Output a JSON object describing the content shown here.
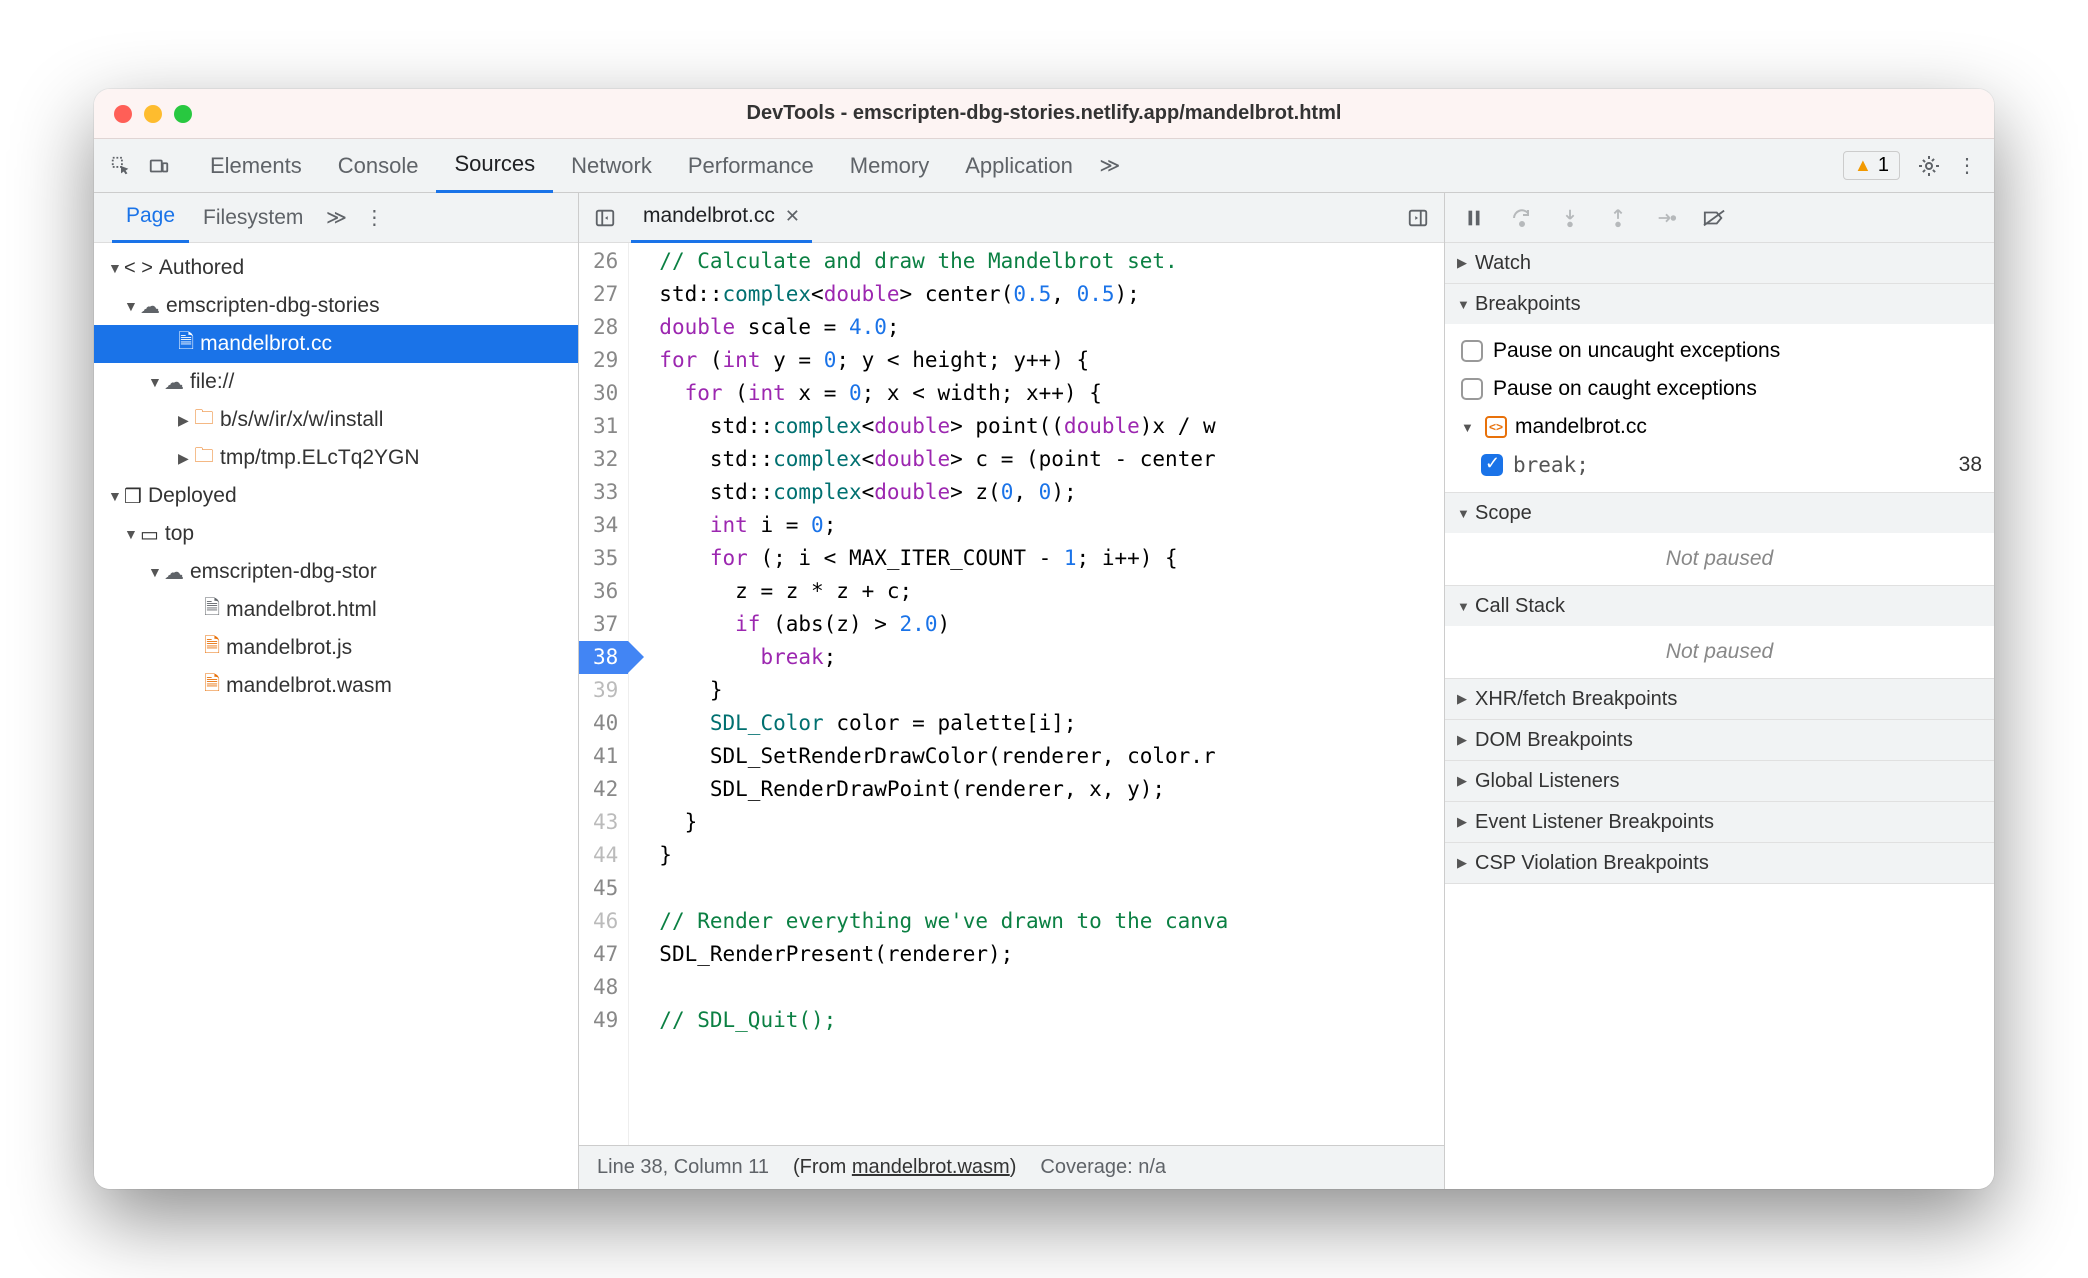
{
  "window_title": "DevTools - emscripten-dbg-stories.netlify.app/mandelbrot.html",
  "tabs": {
    "elements": "Elements",
    "console": "Console",
    "sources": "Sources",
    "network": "Network",
    "performance": "Performance",
    "memory": "Memory",
    "application": "Application"
  },
  "warnings_count": "1",
  "navigator": {
    "tabs": {
      "page": "Page",
      "filesystem": "Filesystem"
    },
    "tree": {
      "authored": "Authored",
      "domain1": "emscripten-dbg-stories",
      "mandelbrot_cc": "mandelbrot.cc",
      "file_scheme": "file://",
      "install_path": "b/s/w/ir/x/w/install",
      "tmp_path": "tmp/tmp.ELcTq2YGN",
      "deployed": "Deployed",
      "top": "top",
      "domain2": "emscripten-dbg-stor",
      "mandelbrot_html": "mandelbrot.html",
      "mandelbrot_js": "mandelbrot.js",
      "mandelbrot_wasm": "mandelbrot.wasm"
    }
  },
  "editor": {
    "tab_label": "mandelbrot.cc",
    "lines": [
      {
        "n": 26,
        "html": "<span class='c-com'>// Calculate and draw the Mandelbrot set.</span>"
      },
      {
        "n": 27,
        "html": "std::<span class='c-id'>complex</span>&lt;<span class='c-kw'>double</span>&gt; center(<span class='c-num'>0.5</span>, <span class='c-num'>0.5</span>);"
      },
      {
        "n": 28,
        "html": "<span class='c-kw'>double</span> scale = <span class='c-num'>4.0</span>;"
      },
      {
        "n": 29,
        "html": "<span class='c-kw'>for</span> (<span class='c-kw'>int</span> y = <span class='c-num'>0</span>; y &lt; height; y++) {"
      },
      {
        "n": 30,
        "html": "  <span class='c-kw'>for</span> (<span class='c-kw'>int</span> x = <span class='c-num'>0</span>; x &lt; width; x++) {"
      },
      {
        "n": 31,
        "html": "    std::<span class='c-id'>complex</span>&lt;<span class='c-kw'>double</span>&gt; point((<span class='c-kw'>double</span>)x / w"
      },
      {
        "n": 32,
        "html": "    std::<span class='c-id'>complex</span>&lt;<span class='c-kw'>double</span>&gt; c = (point - center"
      },
      {
        "n": 33,
        "html": "    std::<span class='c-id'>complex</span>&lt;<span class='c-kw'>double</span>&gt; z(<span class='c-num'>0</span>, <span class='c-num'>0</span>);"
      },
      {
        "n": 34,
        "html": "    <span class='c-kw'>int</span> i = <span class='c-num'>0</span>;"
      },
      {
        "n": 35,
        "html": "    <span class='c-kw'>for</span> (; i &lt; MAX_ITER_COUNT - <span class='c-num'>1</span>; i++) {"
      },
      {
        "n": 36,
        "html": "      z = z * z + c;"
      },
      {
        "n": 37,
        "html": "      <span class='c-kw'>if</span> (abs(z) &gt; <span class='c-num'>2.0</span>)"
      },
      {
        "n": 38,
        "html": "        <span class='c-kw'>break</span>;",
        "bp": true
      },
      {
        "n": 39,
        "html": "    }",
        "faded": true
      },
      {
        "n": 40,
        "html": "    <span class='c-id'>SDL_Color</span> color = palette[i];"
      },
      {
        "n": 41,
        "html": "    SDL_SetRenderDrawColor(renderer, color.r"
      },
      {
        "n": 42,
        "html": "    SDL_RenderDrawPoint(renderer, x, y);"
      },
      {
        "n": 43,
        "html": "  }",
        "faded": true
      },
      {
        "n": 44,
        "html": "}",
        "faded": true
      },
      {
        "n": 45,
        "html": ""
      },
      {
        "n": 46,
        "html": "<span class='c-com'>// Render everything we've drawn to the canva</span>",
        "faded": true
      },
      {
        "n": 47,
        "html": "SDL_RenderPresent(renderer);"
      },
      {
        "n": 48,
        "html": ""
      },
      {
        "n": 49,
        "html": "<span class='c-com'>// SDL_Quit();</span>"
      }
    ],
    "status": {
      "pos": "Line 38, Column 11",
      "from_prefix": "(From ",
      "from_file": "mandelbrot.wasm",
      "from_suffix": ")",
      "coverage": "Coverage: n/a"
    }
  },
  "debugger": {
    "sections": {
      "watch": "Watch",
      "breakpoints": "Breakpoints",
      "pause_uncaught": "Pause on uncaught exceptions",
      "pause_caught": "Pause on caught exceptions",
      "bp_file": "mandelbrot.cc",
      "bp_code": "break;",
      "bp_line": "38",
      "scope": "Scope",
      "not_paused": "Not paused",
      "call_stack": "Call Stack",
      "xhr": "XHR/fetch Breakpoints",
      "dom": "DOM Breakpoints",
      "global": "Global Listeners",
      "event": "Event Listener Breakpoints",
      "csp": "CSP Violation Breakpoints"
    }
  }
}
